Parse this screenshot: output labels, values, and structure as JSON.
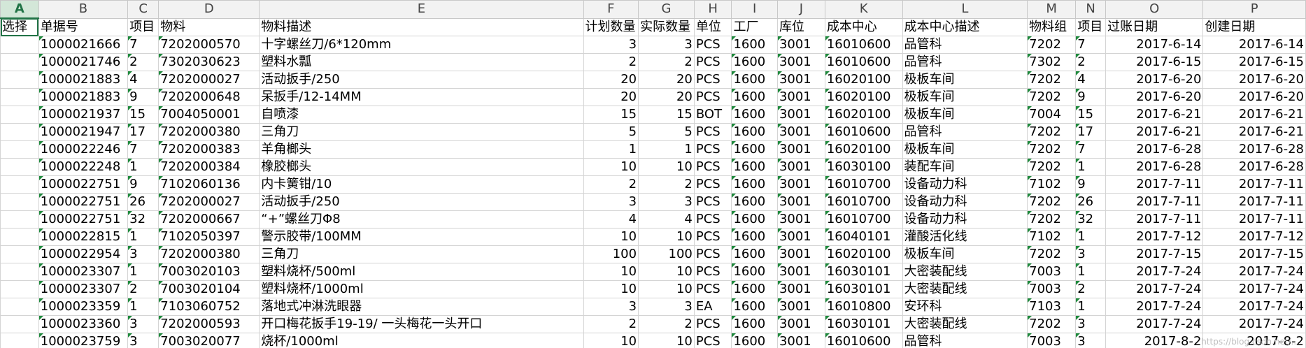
{
  "sheet": {
    "column_letters": [
      "A",
      "B",
      "C",
      "D",
      "E",
      "F",
      "G",
      "H",
      "I",
      "J",
      "K",
      "L",
      "M",
      "N",
      "O",
      "P"
    ],
    "selected_column": "A",
    "headers": [
      "选择",
      "单据号",
      "项目",
      "物料",
      "物料描述",
      "计划数量",
      "实际数量",
      "单位",
      "工厂",
      "库位",
      "成本中心",
      "成本中心描述",
      "物料组",
      "项目",
      "过账日期",
      "创建日期"
    ],
    "rows": [
      [
        "",
        "1000021666",
        "7",
        "7202000570",
        "十字螺丝刀/6*120mm",
        "3",
        "3",
        "PCS",
        "1600",
        "3001",
        "16010600",
        "品管科",
        "7202",
        "7",
        "2017-6-14",
        "2017-6-14"
      ],
      [
        "",
        "1000021746",
        "2",
        "7302030623",
        "塑料水瓢",
        "2",
        "2",
        "PCS",
        "1600",
        "3001",
        "16010600",
        "品管科",
        "7302",
        "2",
        "2017-6-15",
        "2017-6-15"
      ],
      [
        "",
        "1000021883",
        "4",
        "7202000027",
        "活动扳手/250",
        "20",
        "20",
        "PCS",
        "1600",
        "3001",
        "16020100",
        "极板车间",
        "7202",
        "4",
        "2017-6-20",
        "2017-6-20"
      ],
      [
        "",
        "1000021883",
        "9",
        "7202000648",
        "呆扳手/12-14MM",
        "20",
        "20",
        "PCS",
        "1600",
        "3001",
        "16020100",
        "极板车间",
        "7202",
        "9",
        "2017-6-20",
        "2017-6-20"
      ],
      [
        "",
        "1000021937",
        "15",
        "7004050001",
        "自喷漆",
        "15",
        "15",
        "BOT",
        "1600",
        "3001",
        "16020100",
        "极板车间",
        "7004",
        "15",
        "2017-6-21",
        "2017-6-21"
      ],
      [
        "",
        "1000021947",
        "17",
        "7202000380",
        "三角刀",
        "5",
        "5",
        "PCS",
        "1600",
        "3001",
        "16010600",
        "品管科",
        "7202",
        "17",
        "2017-6-21",
        "2017-6-21"
      ],
      [
        "",
        "1000022246",
        "7",
        "7202000383",
        "羊角榔头",
        "1",
        "1",
        "PCS",
        "1600",
        "3001",
        "16020100",
        "极板车间",
        "7202",
        "7",
        "2017-6-28",
        "2017-6-28"
      ],
      [
        "",
        "1000022248",
        "1",
        "7202000384",
        "橡胶榔头",
        "10",
        "10",
        "PCS",
        "1600",
        "3001",
        "16030100",
        "装配车间",
        "7202",
        "1",
        "2017-6-28",
        "2017-6-28"
      ],
      [
        "",
        "1000022751",
        "9",
        "7102060136",
        "内卡簧钳/10",
        "2",
        "2",
        "PCS",
        "1600",
        "3001",
        "16010700",
        "设备动力科",
        "7102",
        "9",
        "2017-7-11",
        "2017-7-11"
      ],
      [
        "",
        "1000022751",
        "26",
        "7202000027",
        "活动扳手/250",
        "3",
        "3",
        "PCS",
        "1600",
        "3001",
        "16010700",
        "设备动力科",
        "7202",
        "26",
        "2017-7-11",
        "2017-7-11"
      ],
      [
        "",
        "1000022751",
        "32",
        "7202000667",
        "“+”螺丝刀Φ8",
        "4",
        "4",
        "PCS",
        "1600",
        "3001",
        "16010700",
        "设备动力科",
        "7202",
        "32",
        "2017-7-11",
        "2017-7-11"
      ],
      [
        "",
        "1000022815",
        "1",
        "7102050397",
        "警示胶带/100MM",
        "10",
        "10",
        "PCS",
        "1600",
        "3001",
        "16040101",
        "灌酸活化线",
        "7102",
        "1",
        "2017-7-12",
        "2017-7-12"
      ],
      [
        "",
        "1000022954",
        "3",
        "7202000380",
        "三角刀",
        "100",
        "100",
        "PCS",
        "1600",
        "3001",
        "16020100",
        "极板车间",
        "7202",
        "3",
        "2017-7-15",
        "2017-7-15"
      ],
      [
        "",
        "1000023307",
        "1",
        "7003020103",
        "塑料烧杯/500ml",
        "10",
        "10",
        "PCS",
        "1600",
        "3001",
        "16030101",
        "大密装配线",
        "7003",
        "1",
        "2017-7-24",
        "2017-7-24"
      ],
      [
        "",
        "1000023307",
        "2",
        "7003020104",
        "塑料烧杯/1000ml",
        "10",
        "10",
        "PCS",
        "1600",
        "3001",
        "16030101",
        "大密装配线",
        "7003",
        "2",
        "2017-7-24",
        "2017-7-24"
      ],
      [
        "",
        "1000023359",
        "1",
        "7103060752",
        "落地式冲淋洗眼器",
        "3",
        "3",
        "EA",
        "1600",
        "3001",
        "16010800",
        "安环科",
        "7103",
        "1",
        "2017-7-24",
        "2017-7-24"
      ],
      [
        "",
        "1000023360",
        "3",
        "7202000593",
        "开口梅花扳手19-19/ 一头梅花一头开口",
        "2",
        "2",
        "PCS",
        "1600",
        "3001",
        "16030101",
        "大密装配线",
        "7202",
        "3",
        "2017-7-24",
        "2017-7-24"
      ],
      [
        "",
        "1000023759",
        "3",
        "7003020077",
        "烧杯/1000ml",
        "10",
        "10",
        "PCS",
        "1600",
        "3001",
        "16010600",
        "品管科",
        "7003",
        "3",
        "2017-8-2",
        "2017-8-2"
      ]
    ],
    "watermark": "https://blog.csdn.net/..."
  }
}
